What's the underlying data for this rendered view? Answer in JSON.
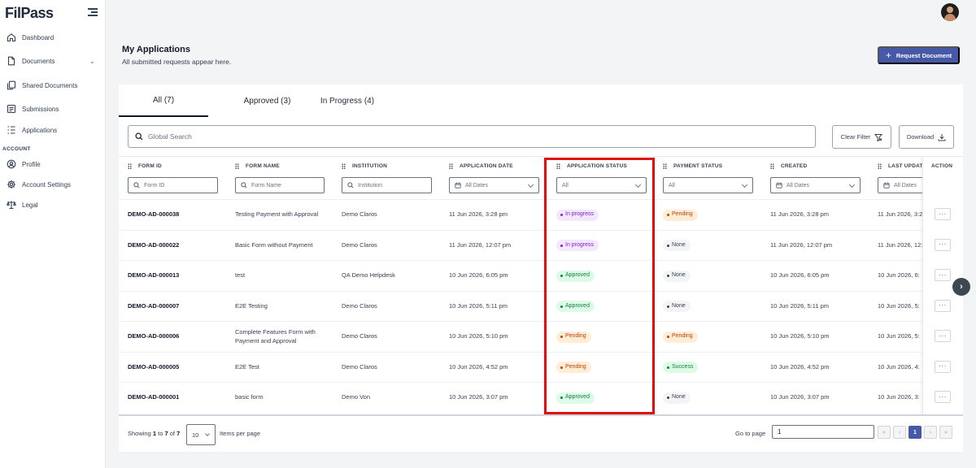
{
  "brand": {
    "logo_text": "FilPass"
  },
  "sidebar": {
    "items": [
      {
        "label": "Dashboard",
        "icon": "home-icon"
      },
      {
        "label": "Documents",
        "icon": "document-icon"
      },
      {
        "label": "Shared Documents",
        "icon": "shared-documents-icon"
      },
      {
        "label": "Submissions",
        "icon": "submissions-icon"
      },
      {
        "label": "Applications",
        "icon": "applications-icon"
      }
    ],
    "section_label": "ACCOUNT",
    "account_items": [
      {
        "label": "Profile",
        "icon": "profile-icon"
      },
      {
        "label": "Account Settings",
        "icon": "gear-icon"
      },
      {
        "label": "Legal",
        "icon": "scale-icon"
      }
    ]
  },
  "header": {
    "title": "My Applications",
    "subtitle": "All submitted requests appear here.",
    "request_button": "Request Document"
  },
  "tabs": [
    {
      "label": "All (7)"
    },
    {
      "label": "Approved (3)"
    },
    {
      "label": "In Progress (4)"
    }
  ],
  "search": {
    "placeholder": "Global Search"
  },
  "toolbar": {
    "clear_filter": "Clear Filter",
    "download": "Download"
  },
  "table": {
    "columns": [
      "FORM ID",
      "FORM NAME",
      "INSTITUTION",
      "APPLICATION DATE",
      "APPLICATION STATUS",
      "PAYMENT STATUS",
      "CREATED",
      "LAST UPDAT",
      "ACTION"
    ],
    "filters": {
      "form_id": "Form ID",
      "form_name": "Form Name",
      "institution": "Institution",
      "application_date": "All Dates",
      "application_status": "All",
      "payment_status": "All",
      "created": "All Dates",
      "last_updated": "All Dates"
    },
    "rows": [
      {
        "form_id": "DEMO-AD-000038",
        "form_name": "Testing Payment with Approval",
        "institution": "Demo Claros",
        "application_date": "11 Jun 2026, 3:28 pm",
        "application_status": "In progress",
        "payment_status": "Pending",
        "created": "11 Jun 2026, 3:28 pm",
        "last_updated": "11 Jun 2026, 3:2"
      },
      {
        "form_id": "DEMO-AD-000022",
        "form_name": "Basic Form without Payment",
        "institution": "Demo Claros",
        "application_date": "11 Jun 2026, 12:07 pm",
        "application_status": "In progress",
        "payment_status": "None",
        "created": "11 Jun 2026, 12:07 pm",
        "last_updated": "11 Jun 2026, 12:"
      },
      {
        "form_id": "DEMO-AD-000013",
        "form_name": "test",
        "institution": "QA Demo Helpdesk",
        "application_date": "10 Jun 2026, 6:05 pm",
        "application_status": "Approved",
        "payment_status": "None",
        "created": "10 Jun 2026, 6:05 pm",
        "last_updated": "10 Jun 2026, 6:"
      },
      {
        "form_id": "DEMO-AD-000007",
        "form_name": "E2E Testing",
        "institution": "Demo Claros",
        "application_date": "10 Jun 2026, 5:11 pm",
        "application_status": "Approved",
        "payment_status": "None",
        "created": "10 Jun 2026, 5:11 pm",
        "last_updated": "10 Jun 2026, 5:"
      },
      {
        "form_id": "DEMO-AD-000006",
        "form_name": "Complete Features Form with Payment and Approval",
        "institution": "Demo Claros",
        "application_date": "10 Jun 2026, 5:10 pm",
        "application_status": "Pending",
        "payment_status": "Pending",
        "created": "10 Jun 2026, 5:10 pm",
        "last_updated": "10 Jun 2026, 5:"
      },
      {
        "form_id": "DEMO-AD-000005",
        "form_name": "E2E Test",
        "institution": "Demo Claros",
        "application_date": "10 Jun 2026, 4:52 pm",
        "application_status": "Pending",
        "payment_status": "Success",
        "created": "10 Jun 2026, 4:52 pm",
        "last_updated": "10 Jun 2026, 4:"
      },
      {
        "form_id": "DEMO-AD-000001",
        "form_name": "basic form",
        "institution": "Demo Von",
        "application_date": "10 Jun 2026, 3:07 pm",
        "application_status": "Approved",
        "payment_status": "None",
        "created": "10 Jun 2026, 3:07 pm",
        "last_updated": "10 Jun 2026, 3:"
      }
    ],
    "action_label": "···"
  },
  "status_colors": {
    "In progress": {
      "bg": "#f3e8ff",
      "fg": "#7e22ce"
    },
    "Approved": {
      "bg": "#dcfce7",
      "fg": "#15803d"
    },
    "Pending": {
      "bg": "#ffedd5",
      "fg": "#c2410c"
    },
    "Success": {
      "bg": "#dcfce7",
      "fg": "#15803d"
    },
    "None": {
      "bg": "#f3f4f6",
      "fg": "#374151"
    }
  },
  "pagination": {
    "showing_prefix": "Showing",
    "from": "1",
    "to_word": "to",
    "to": "7",
    "of_word": "of",
    "total": "7",
    "per_page": "10",
    "per_page_label": "Items per page",
    "goto_label": "Go to page",
    "goto_value": "1",
    "first": "«",
    "prev": "‹",
    "current": "1",
    "next": "›",
    "last": "»"
  },
  "highlight_color": "#e30b0b",
  "accent_color": "#4658a8"
}
